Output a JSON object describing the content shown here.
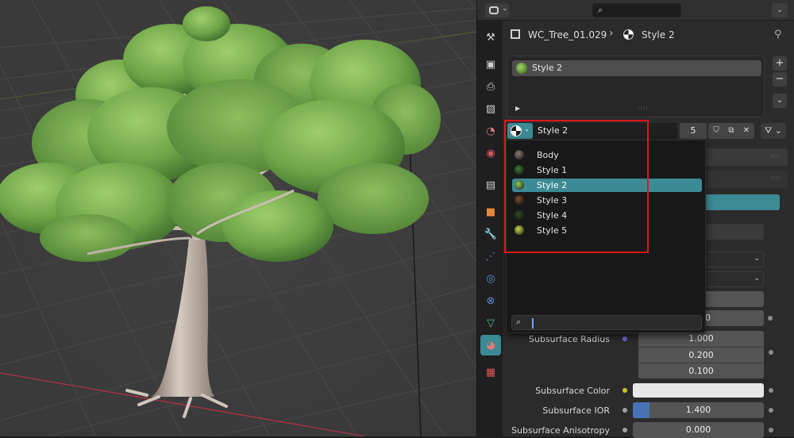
{
  "breadcrumb": {
    "object": "WC_Tree_01.029",
    "separator": "›",
    "material": "Style 2"
  },
  "slots": {
    "items": [
      {
        "label": "Style 2"
      }
    ],
    "add_label": "+",
    "remove_label": "−",
    "more_label": "⌄"
  },
  "material_selector": {
    "name": "Style 2",
    "users": "5"
  },
  "popup": {
    "items": [
      {
        "label": "Body",
        "swatch": "#8a7b6c"
      },
      {
        "label": "Style 1",
        "swatch": "#3f7a2e"
      },
      {
        "label": "Style 2",
        "swatch": "#8fcf58",
        "selected": true
      },
      {
        "label": "Style 3",
        "swatch": "#7a4a2a"
      },
      {
        "label": "Style 4",
        "swatch": "#314a25"
      },
      {
        "label": "Style 5",
        "swatch": "#c9d84a"
      }
    ],
    "search_placeholder": ""
  },
  "properties": {
    "partial_value": "0",
    "subsurface_radius": {
      "label": "Subsurface Radius",
      "values": [
        "1.000",
        "0.200",
        "0.100"
      ]
    },
    "subsurface_color": {
      "label": "Subsurface Color",
      "value": "#e8e8e8"
    },
    "subsurface_ior": {
      "label": "Subsurface IOR",
      "value": "1.400",
      "fill_fraction": 0.13
    },
    "subsurface_anisotropy": {
      "label": "Subsurface Anisotropy",
      "value": "0.000"
    }
  },
  "colors": {
    "accent": "#3c8a94",
    "annotation": "#e0161b",
    "ior_fill": "#4772b3"
  }
}
